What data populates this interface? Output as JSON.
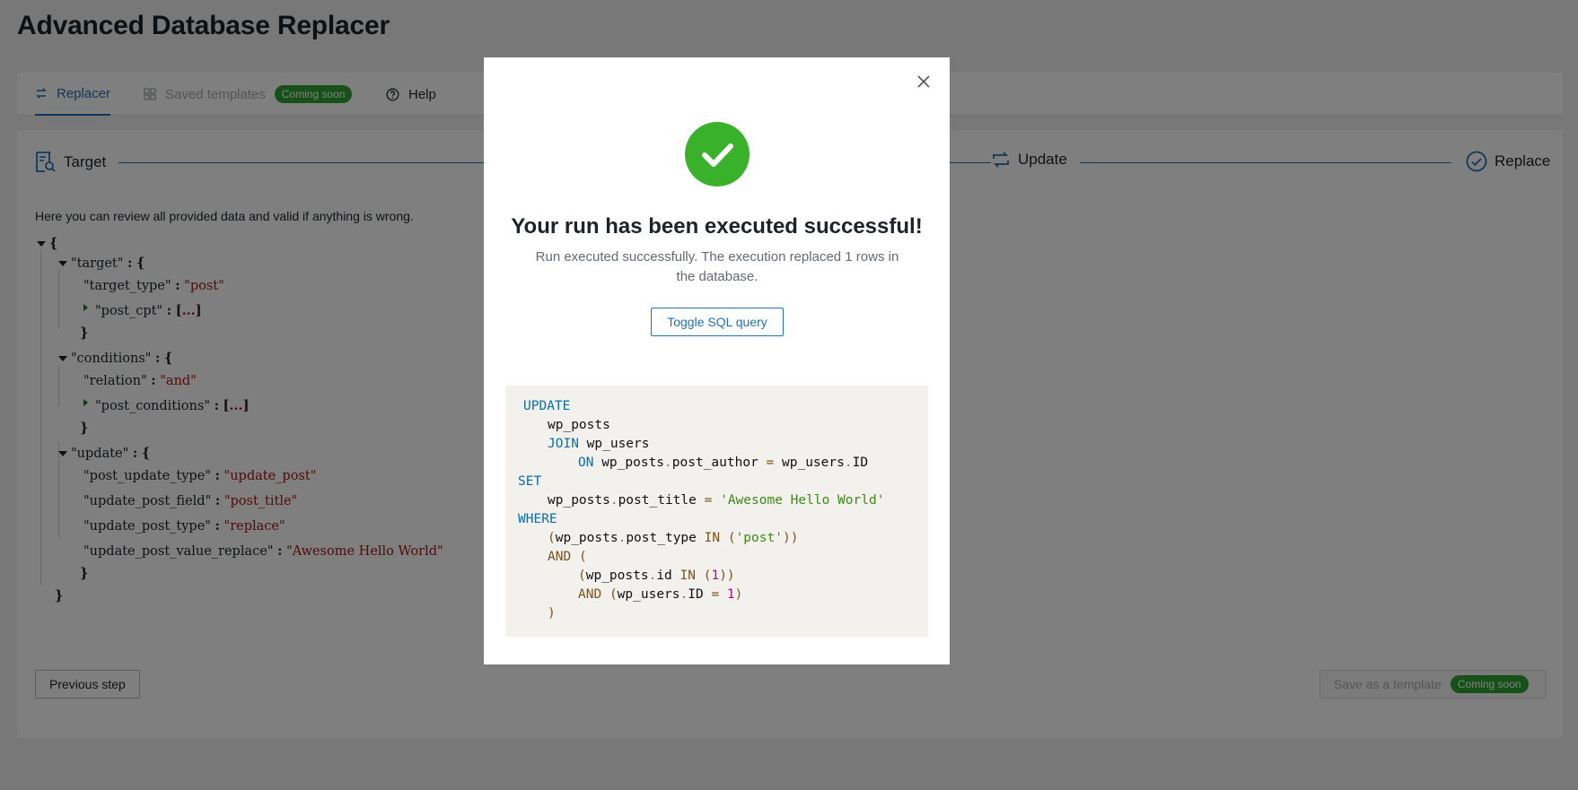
{
  "page": {
    "title": "Advanced Database Replacer"
  },
  "tabs": [
    {
      "label": "Replacer",
      "icon": "replace-icon",
      "state": "active"
    },
    {
      "label": "Saved templates",
      "icon": "grid-icon",
      "state": "disabled",
      "badge": "Coming soon"
    },
    {
      "label": "Help",
      "icon": "help-circle-icon",
      "state": "normal"
    }
  ],
  "stepper": {
    "steps": [
      {
        "label": "Target",
        "icon": "search-document-icon"
      },
      {
        "label": "Update",
        "icon": "repeat-icon"
      },
      {
        "label": "Replace",
        "icon": "check-circle-icon"
      }
    ]
  },
  "review": {
    "intro": "Here you can review all provided data and valid if anything is wrong.",
    "json": {
      "open_brace": "{",
      "close_brace": "}",
      "target_key": "\"target\"",
      "target_type_key": "\"target_type\"",
      "target_type_val": "\"post\"",
      "post_cpt_key": "\"post_cpt\"",
      "conditions_key": "\"conditions\"",
      "relation_key": "\"relation\"",
      "relation_val": "\"and\"",
      "post_conditions_key": "\"post_conditions\"",
      "update_key": "\"update\"",
      "post_update_type_key": "\"post_update_type\"",
      "post_update_type_val": "\"update_post\"",
      "update_post_field_key": "\"update_post_field\"",
      "update_post_field_val": "\"post_title\"",
      "update_post_type_key": "\"update_post_type\"",
      "update_post_type_val": "\"replace\"",
      "update_post_value_replace_key": "\"update_post_value_replace\"",
      "update_post_value_replace_val": "\"Awesome Hello World\"",
      "colon": ":",
      "ellipsis": "...",
      "lbracket": "[",
      "rbracket": "]"
    }
  },
  "footer": {
    "previous_label": "Previous step",
    "save_label": "Save as a template",
    "save_badge": "Coming soon"
  },
  "modal": {
    "title": "Your run has been executed successful!",
    "message": "Run executed successfully. The execution replaced 1 rows in the database.",
    "toggle_label": "Toggle SQL query",
    "icon": "check-circle-icon",
    "sql": {
      "update": "UPDATE",
      "table": "wp_posts",
      "join": "JOIN",
      "join_table": "wp_users",
      "on": "ON",
      "on_left_a": "wp_posts",
      "on_left_b": "post_author",
      "eq": "=",
      "on_right_a": "wp_users",
      "on_right_b": "ID",
      "set": "SET",
      "set_left_a": "wp_posts",
      "set_left_b": "post_title",
      "set_value": "'Awesome Hello World'",
      "where": "WHERE",
      "w1_a": "wp_posts",
      "w1_b": "post_type",
      "in": "IN",
      "w1_val": "'post'",
      "and": "AND",
      "w2_a": "wp_posts",
      "w2_b": "id",
      "w2_val": "1",
      "w3_a": "wp_users",
      "w3_b": "ID",
      "w3_val": "1",
      "dot": ".",
      "lparen": "(",
      "rparen": ")"
    }
  },
  "colors": {
    "accent": "#2271b1",
    "success": "#2fa332",
    "overlay": "rgba(0,0,0,0.5)"
  }
}
